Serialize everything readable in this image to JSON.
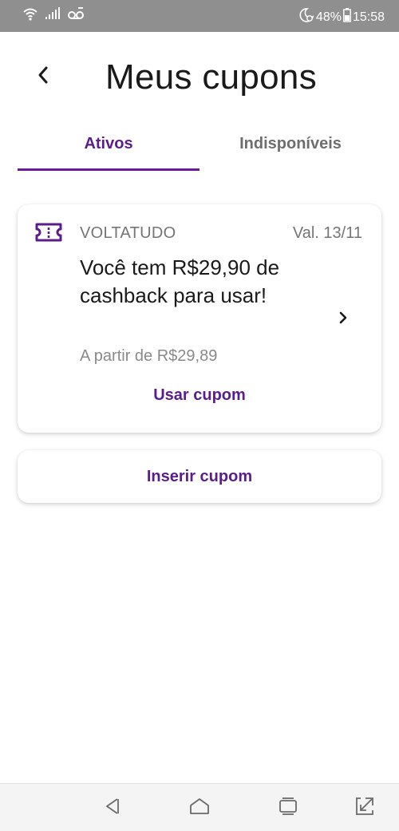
{
  "status_bar": {
    "battery": "48%",
    "time": "15:58",
    "icons": [
      "wifi-icon",
      "signal-icon",
      "voicemail-icon",
      "do-not-disturb-icon",
      "battery-icon"
    ]
  },
  "header": {
    "title": "Meus cupons",
    "back_icon": "chevron-left-icon"
  },
  "tabs": [
    {
      "label": "Ativos",
      "active": true
    },
    {
      "label": "Indisponíveis",
      "active": false
    }
  ],
  "coupon": {
    "icon": "ticket-icon",
    "code": "VOLTATUDO",
    "validity": "Val. 13/11",
    "description": "Você tem R$29,90 de cashback para usar!",
    "minimum": "A partir de R$29,89",
    "action_label": "Usar cupom"
  },
  "insert_button": {
    "label": "Inserir cupom"
  },
  "nav_bar": {
    "icons": [
      "back-triangle-icon",
      "home-icon",
      "recents-icon",
      "expand-icon"
    ]
  },
  "colors": {
    "accent": "#5b1d8c",
    "status_bar": "#8f8f8f",
    "text_primary": "#1a1a1a",
    "text_secondary": "#757575"
  }
}
